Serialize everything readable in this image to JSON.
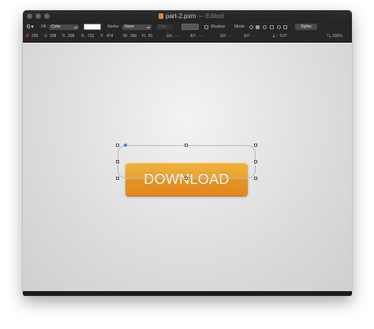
{
  "window": {
    "filename": "part-2.pxm",
    "status": "— Edited"
  },
  "toolbar": {
    "fill_label": "Fill:",
    "fill_mode": "Color",
    "stroke_label": "Stroke",
    "stroke_mode": "None",
    "stroke_width": "3 px",
    "shadow_label": "Shadow",
    "mode_label": "Mode:",
    "styles_label": "Styles",
    "fill_color": "#ffffff",
    "stroke_color": "#555555"
  },
  "info": {
    "r_label": "R",
    "r_value": "256",
    "g_label": "G",
    "g_value": "208",
    "b_label": "B",
    "b_value": "208",
    "x_label": "X:",
    "x_value": "732",
    "y_label": "Y:",
    "y_value": "474",
    "w_label": "W:",
    "w_value": "340",
    "h_label": "H:",
    "h_value": "81",
    "dx_label": "ΔX:",
    "dx_value": "----",
    "dy_label": "ΔY:",
    "dy_value": "----",
    "dx2_label": "ΔX:",
    "dx2_value": "----",
    "dy2_label": "ΔY:",
    "dy2_value": "----",
    "angle_label": "∠:",
    "angle_value": "0.0°",
    "zoom": "100%"
  },
  "canvas": {
    "button_text": "DOWNLOAD",
    "button_color_top": "#efb13b",
    "button_color_bottom": "#e2871e",
    "selection_handle_color": "#4a7fd0"
  }
}
